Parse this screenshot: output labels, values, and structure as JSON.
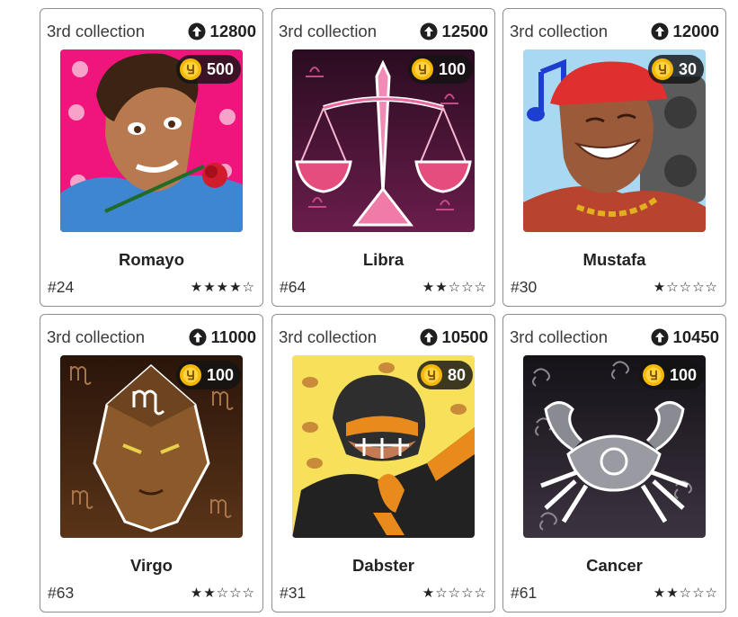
{
  "cards": [
    {
      "collection": "3rd collection",
      "score": "12800",
      "price": "500",
      "name": "Romayo",
      "number": "#24",
      "stars": "★★★★☆",
      "rating": 4,
      "bg": "#f0147d",
      "icon": "rose-icon"
    },
    {
      "collection": "3rd collection",
      "score": "12500",
      "price": "100",
      "name": "Libra",
      "number": "#64",
      "stars": "★★☆☆☆",
      "rating": 2,
      "bg": "#5a1840",
      "icon": "libra-icon"
    },
    {
      "collection": "3rd collection",
      "score": "12000",
      "price": "30",
      "name": "Mustafa",
      "number": "#30",
      "stars": "★☆☆☆☆",
      "rating": 1,
      "bg": "#a9d8f2",
      "icon": "music-note-icon"
    },
    {
      "collection": "3rd collection",
      "score": "11000",
      "price": "100",
      "name": "Virgo",
      "number": "#63",
      "stars": "★★☆☆☆",
      "rating": 2,
      "bg": "#3a2012",
      "icon": "virgo-icon"
    },
    {
      "collection": "3rd collection",
      "score": "10500",
      "price": "80",
      "name": "Dabster",
      "number": "#31",
      "stars": "★☆☆☆☆",
      "rating": 1,
      "bg": "#f7e15a",
      "icon": "football-icon"
    },
    {
      "collection": "3rd collection",
      "score": "10450",
      "price": "100",
      "name": "Cancer",
      "number": "#61",
      "stars": "★★☆☆☆",
      "rating": 2,
      "bg": "#2b2530",
      "icon": "cancer-icon"
    }
  ]
}
